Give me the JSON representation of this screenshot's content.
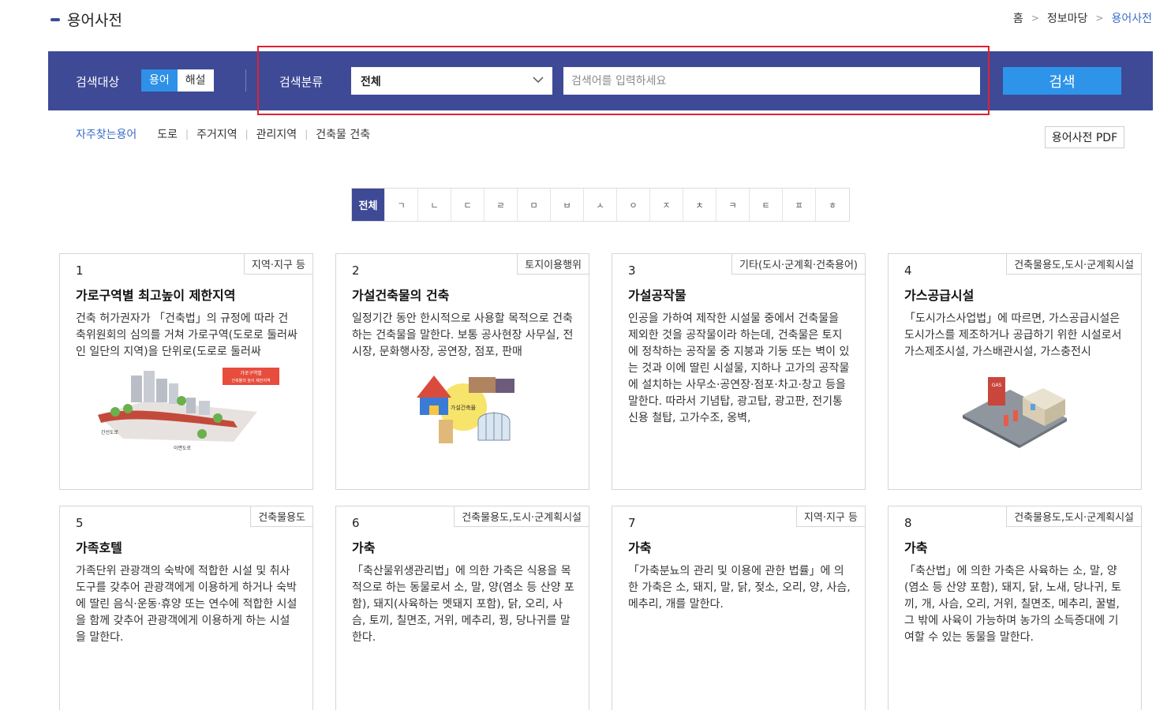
{
  "header": {
    "title": "용어사전"
  },
  "breadcrumb": [
    "홈",
    "정보마당",
    "용어사전"
  ],
  "search": {
    "target_label": "검색대상",
    "target_options": [
      "용어",
      "해설"
    ],
    "category_label": "검색분류",
    "category_value": "전체",
    "placeholder": "검색어를 입력하세요",
    "button": "검색"
  },
  "faq": {
    "label": "자주찾는용어",
    "items": [
      "도로",
      "주거지역",
      "관리지역",
      "건축물 건축"
    ]
  },
  "pdf_button": "용어사전 PDF",
  "index": [
    "전체",
    "ㄱ",
    "ㄴ",
    "ㄷ",
    "ㄹ",
    "ㅁ",
    "ㅂ",
    "ㅅ",
    "ㅇ",
    "ㅈ",
    "ㅊ",
    "ㅋ",
    "ㅌ",
    "ㅍ",
    "ㅎ"
  ],
  "colors": {
    "band": "#3e4a96",
    "accent": "#2e94ea",
    "highlight": "#e0212f"
  },
  "cards": [
    {
      "num": "1",
      "tag": "지역·지구 등",
      "title": "가로구역별 최고높이 제한지역",
      "desc": "건축 허가권자가 「건축법」의 규정에 따라 건축위원회의 심의를 거쳐 가로구역(도로로 둘러싸인 일단의 지역)을 단위로(도로로 둘러싸",
      "illus_text": [
        "가로구역별",
        "건축물의 높이 제한지역",
        "간선도로",
        "이면도로"
      ]
    },
    {
      "num": "2",
      "tag": "토지이용행위",
      "title": "가설건축물의 건축",
      "desc": "일정기간 동안 한시적으로 사용할 목적으로 건축하는 건축물을 말한다. 보통 공사현장 사무실, 전시장, 문화행사장, 공연장, 점포, 판매",
      "illus_text": [
        "가설건축물"
      ]
    },
    {
      "num": "3",
      "tag": "기타(도시·군계획·건축용어)",
      "title": "가설공작물",
      "desc": "인공을 가하여 제작한 시설물 중에서 건축물을 제외한 것을 공작물이라 하는데, 건축물은 토지에 정착하는 공작물 중 지붕과 기둥 또는 벽이 있는 것과 이에 딸린 시설물, 지하나 고가의 공작물에 설치하는 사무소·공연장·점포·차고·창고 등을 말한다. 따라서 기념탑, 광고탑, 광고판, 전기통신용 철탑, 고가수조, 옹벽,"
    },
    {
      "num": "4",
      "tag": "건축물용도,도시·군계획시설",
      "title": "가스공급시설",
      "desc": "「도시가스사업법」에 따르면, 가스공급시설은 도시가스를 제조하거나 공급하기 위한 시설로서 가스제조시설, 가스배관시설, 가스충전시",
      "illus_text": [
        "GAS"
      ]
    },
    {
      "num": "5",
      "tag": "건축물용도",
      "title": "가족호텔",
      "desc": "가족단위 관광객의 숙박에 적합한 시설 및 취사도구를 갖추어 관광객에게 이용하게 하거나 숙박에 딸린 음식·운동·휴양 또는 연수에 적합한 시설을 함께 갖추어 관광객에게 이용하게 하는 시설을 말한다."
    },
    {
      "num": "6",
      "tag": "건축물용도,도시·군계획시설",
      "title": "가축",
      "desc": "「축산물위생관리법」에 의한 가축은 식용을 목적으로 하는 동물로서 소, 말, 양(염소 등 산양 포함), 돼지(사육하는 멧돼지 포함), 닭, 오리, 사슴, 토끼, 칠면조, 거위, 메추리, 꿩, 당나귀를 말한다."
    },
    {
      "num": "7",
      "tag": "지역·지구 등",
      "title": "가축",
      "desc": "「가축분뇨의 관리 및 이용에 관한 법률」에 의한 가축은 소, 돼지, 말, 닭, 젖소, 오리, 양, 사슴, 메추리, 개를 말한다."
    },
    {
      "num": "8",
      "tag": "건축물용도,도시·군계획시설",
      "title": "가축",
      "desc": "「축산법」에 의한 가축은 사육하는 소, 말, 양(염소 등 산양 포함), 돼지, 닭, 노새, 당나귀, 토끼, 개, 사슴, 오리, 거위, 칠면조, 메추리, 꿀벌, 그 밖에 사육이 가능하며 농가의 소득증대에 기여할 수 있는 동물을 말한다."
    }
  ]
}
